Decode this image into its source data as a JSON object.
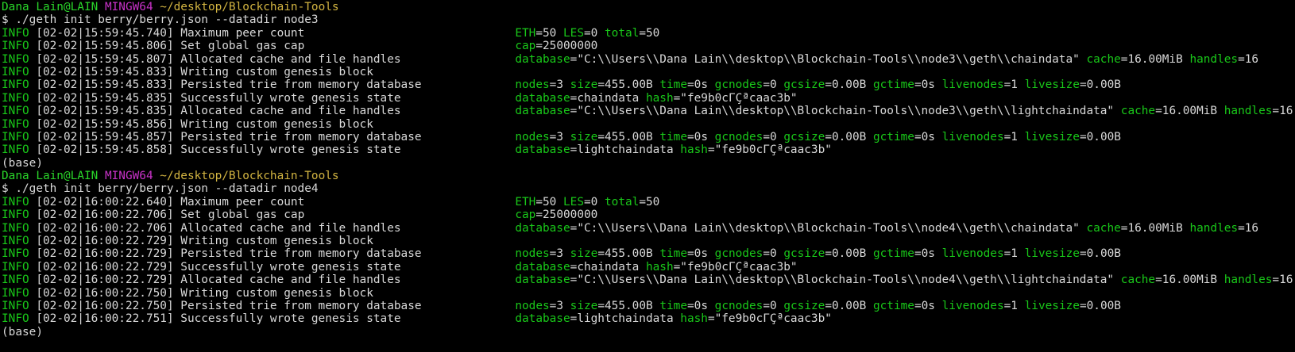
{
  "terminal": {
    "colors": {
      "background": "#000000",
      "text": "#d9d9d9",
      "info": "#19c819",
      "user": "#2ad62a",
      "host": "#c832c8",
      "path": "#d2b441",
      "key": "#19c819"
    },
    "lines": [
      {
        "kind": "prompt",
        "user": "Dana Lain@LAIN",
        "host": "MINGW64",
        "path": "~/desktop/Blockchain-Tools"
      },
      {
        "kind": "command",
        "text": "$ ./geth init berry/berry.json --datadir node3"
      },
      {
        "kind": "log",
        "level": "INFO",
        "time": "[02-02|15:59:45.740]",
        "msg": "Maximum peer count",
        "fields": [
          {
            "k": "ETH",
            "v": "50"
          },
          {
            "k": "LES",
            "v": "0"
          },
          {
            "k": "total",
            "v": "50"
          }
        ]
      },
      {
        "kind": "log",
        "level": "INFO",
        "time": "[02-02|15:59:45.806]",
        "msg": "Set global gas cap",
        "fields": [
          {
            "k": "cap",
            "v": "25000000"
          }
        ]
      },
      {
        "kind": "log",
        "level": "INFO",
        "time": "[02-02|15:59:45.807]",
        "msg": "Allocated cache and file handles",
        "fields": [
          {
            "k": "database",
            "v": "\"C:\\\\Users\\\\Dana Lain\\\\desktop\\\\Blockchain-Tools\\\\node3\\\\geth\\\\chaindata\""
          },
          {
            "k": "cache",
            "v": "16.00MiB"
          },
          {
            "k": "handles",
            "v": "16"
          }
        ]
      },
      {
        "kind": "log",
        "level": "INFO",
        "time": "[02-02|15:59:45.833]",
        "msg": "Writing custom genesis block",
        "fields": []
      },
      {
        "kind": "log",
        "level": "INFO",
        "time": "[02-02|15:59:45.833]",
        "msg": "Persisted trie from memory database",
        "fields": [
          {
            "k": "nodes",
            "v": "3"
          },
          {
            "k": "size",
            "v": "455.00B"
          },
          {
            "k": "time",
            "v": "0s"
          },
          {
            "k": "gcnodes",
            "v": "0"
          },
          {
            "k": "gcsize",
            "v": "0.00B"
          },
          {
            "k": "gctime",
            "v": "0s"
          },
          {
            "k": "livenodes",
            "v": "1"
          },
          {
            "k": "livesize",
            "v": "0.00B"
          }
        ]
      },
      {
        "kind": "log",
        "level": "INFO",
        "time": "[02-02|15:59:45.835]",
        "msg": "Successfully wrote genesis state",
        "fields": [
          {
            "k": "database",
            "v": "chaindata"
          },
          {
            "k": "hash",
            "v": "\"fe9b0cΓÇªcaac3b\""
          }
        ]
      },
      {
        "kind": "log",
        "level": "INFO",
        "time": "[02-02|15:59:45.835]",
        "msg": "Allocated cache and file handles",
        "fields": [
          {
            "k": "database",
            "v": "\"C:\\\\Users\\\\Dana Lain\\\\desktop\\\\Blockchain-Tools\\\\node3\\\\geth\\\\lightchaindata\""
          },
          {
            "k": "cache",
            "v": "16.00MiB"
          },
          {
            "k": "handles",
            "v": "16"
          }
        ]
      },
      {
        "kind": "log",
        "level": "INFO",
        "time": "[02-02|15:59:45.856]",
        "msg": "Writing custom genesis block",
        "fields": []
      },
      {
        "kind": "log",
        "level": "INFO",
        "time": "[02-02|15:59:45.857]",
        "msg": "Persisted trie from memory database",
        "fields": [
          {
            "k": "nodes",
            "v": "3"
          },
          {
            "k": "size",
            "v": "455.00B"
          },
          {
            "k": "time",
            "v": "0s"
          },
          {
            "k": "gcnodes",
            "v": "0"
          },
          {
            "k": "gcsize",
            "v": "0.00B"
          },
          {
            "k": "gctime",
            "v": "0s"
          },
          {
            "k": "livenodes",
            "v": "1"
          },
          {
            "k": "livesize",
            "v": "0.00B"
          }
        ]
      },
      {
        "kind": "log",
        "level": "INFO",
        "time": "[02-02|15:59:45.858]",
        "msg": "Successfully wrote genesis state",
        "fields": [
          {
            "k": "database",
            "v": "lightchaindata"
          },
          {
            "k": "hash",
            "v": "\"fe9b0cΓÇªcaac3b\""
          }
        ]
      },
      {
        "kind": "plain",
        "text": "(base)"
      },
      {
        "kind": "prompt",
        "user": "Dana Lain@LAIN",
        "host": "MINGW64",
        "path": "~/desktop/Blockchain-Tools"
      },
      {
        "kind": "command",
        "text": "$ ./geth init berry/berry.json --datadir node4"
      },
      {
        "kind": "log",
        "level": "INFO",
        "time": "[02-02|16:00:22.640]",
        "msg": "Maximum peer count",
        "fields": [
          {
            "k": "ETH",
            "v": "50"
          },
          {
            "k": "LES",
            "v": "0"
          },
          {
            "k": "total",
            "v": "50"
          }
        ]
      },
      {
        "kind": "log",
        "level": "INFO",
        "time": "[02-02|16:00:22.706]",
        "msg": "Set global gas cap",
        "fields": [
          {
            "k": "cap",
            "v": "25000000"
          }
        ]
      },
      {
        "kind": "log",
        "level": "INFO",
        "time": "[02-02|16:00:22.706]",
        "msg": "Allocated cache and file handles",
        "fields": [
          {
            "k": "database",
            "v": "\"C:\\\\Users\\\\Dana Lain\\\\desktop\\\\Blockchain-Tools\\\\node4\\\\geth\\\\chaindata\""
          },
          {
            "k": "cache",
            "v": "16.00MiB"
          },
          {
            "k": "handles",
            "v": "16"
          }
        ]
      },
      {
        "kind": "log",
        "level": "INFO",
        "time": "[02-02|16:00:22.729]",
        "msg": "Writing custom genesis block",
        "fields": []
      },
      {
        "kind": "log",
        "level": "INFO",
        "time": "[02-02|16:00:22.729]",
        "msg": "Persisted trie from memory database",
        "fields": [
          {
            "k": "nodes",
            "v": "3"
          },
          {
            "k": "size",
            "v": "455.00B"
          },
          {
            "k": "time",
            "v": "0s"
          },
          {
            "k": "gcnodes",
            "v": "0"
          },
          {
            "k": "gcsize",
            "v": "0.00B"
          },
          {
            "k": "gctime",
            "v": "0s"
          },
          {
            "k": "livenodes",
            "v": "1"
          },
          {
            "k": "livesize",
            "v": "0.00B"
          }
        ]
      },
      {
        "kind": "log",
        "level": "INFO",
        "time": "[02-02|16:00:22.729]",
        "msg": "Successfully wrote genesis state",
        "fields": [
          {
            "k": "database",
            "v": "chaindata"
          },
          {
            "k": "hash",
            "v": "\"fe9b0cΓÇªcaac3b\""
          }
        ]
      },
      {
        "kind": "log",
        "level": "INFO",
        "time": "[02-02|16:00:22.729]",
        "msg": "Allocated cache and file handles",
        "fields": [
          {
            "k": "database",
            "v": "\"C:\\\\Users\\\\Dana Lain\\\\desktop\\\\Blockchain-Tools\\\\node4\\\\geth\\\\lightchaindata\""
          },
          {
            "k": "cache",
            "v": "16.00MiB"
          },
          {
            "k": "handles",
            "v": "16"
          }
        ]
      },
      {
        "kind": "log",
        "level": "INFO",
        "time": "[02-02|16:00:22.750]",
        "msg": "Writing custom genesis block",
        "fields": []
      },
      {
        "kind": "log",
        "level": "INFO",
        "time": "[02-02|16:00:22.750]",
        "msg": "Persisted trie from memory database",
        "fields": [
          {
            "k": "nodes",
            "v": "3"
          },
          {
            "k": "size",
            "v": "455.00B"
          },
          {
            "k": "time",
            "v": "0s"
          },
          {
            "k": "gcnodes",
            "v": "0"
          },
          {
            "k": "gcsize",
            "v": "0.00B"
          },
          {
            "k": "gctime",
            "v": "0s"
          },
          {
            "k": "livenodes",
            "v": "1"
          },
          {
            "k": "livesize",
            "v": "0.00B"
          }
        ]
      },
      {
        "kind": "log",
        "level": "INFO",
        "time": "[02-02|16:00:22.751]",
        "msg": "Successfully wrote genesis state",
        "fields": [
          {
            "k": "database",
            "v": "lightchaindata"
          },
          {
            "k": "hash",
            "v": "\"fe9b0cΓÇªcaac3b\""
          }
        ]
      },
      {
        "kind": "plain",
        "text": "(base)"
      }
    ]
  }
}
